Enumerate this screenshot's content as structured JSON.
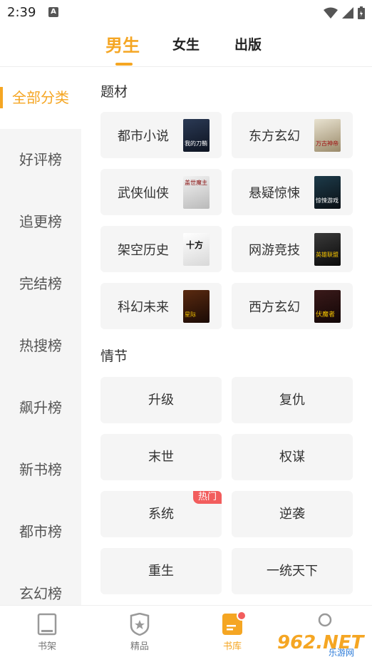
{
  "status_bar": {
    "time": "2:39",
    "app_icon": "A"
  },
  "tabs": [
    {
      "label": "男生",
      "active": true
    },
    {
      "label": "女生",
      "active": false
    },
    {
      "label": "出版",
      "active": false
    }
  ],
  "sidebar": {
    "items": [
      {
        "label": "全部分类",
        "active": true
      },
      {
        "label": "好评榜"
      },
      {
        "label": "追更榜"
      },
      {
        "label": "完结榜"
      },
      {
        "label": "热搜榜"
      },
      {
        "label": "飙升榜"
      },
      {
        "label": "新书榜"
      },
      {
        "label": "都市榜"
      },
      {
        "label": "玄幻榜"
      }
    ]
  },
  "genre_section": {
    "title": "题材",
    "items": [
      {
        "label": "都市小说",
        "cover_title": "我的刀鞘"
      },
      {
        "label": "东方玄幻",
        "cover_title": "万古神帝"
      },
      {
        "label": "武侠仙侠",
        "cover_title": "盖世魔主"
      },
      {
        "label": "悬疑惊悚",
        "cover_title": "惊悚游戏"
      },
      {
        "label": "架空历史",
        "cover_title": "十方"
      },
      {
        "label": "网游竞技",
        "cover_title": "英雄联盟"
      },
      {
        "label": "科幻未来",
        "cover_title": "星际"
      },
      {
        "label": "西方玄幻",
        "cover_title": "伏魔者"
      }
    ]
  },
  "plot_section": {
    "title": "情节",
    "items": [
      {
        "label": "升级"
      },
      {
        "label": "复仇"
      },
      {
        "label": "末世"
      },
      {
        "label": "权谋"
      },
      {
        "label": "系统",
        "badge": "热门"
      },
      {
        "label": "逆袭"
      },
      {
        "label": "重生"
      },
      {
        "label": "一统天下"
      }
    ]
  },
  "bottom_nav": {
    "items": [
      {
        "label": "书架"
      },
      {
        "label": "精品"
      },
      {
        "label": "书库",
        "active": true
      },
      {
        "label": ""
      }
    ]
  },
  "watermark": {
    "text": "962.NET",
    "sub": "乐游网"
  },
  "colors": {
    "accent": "#f5a623",
    "badge": "#f25d5d"
  }
}
